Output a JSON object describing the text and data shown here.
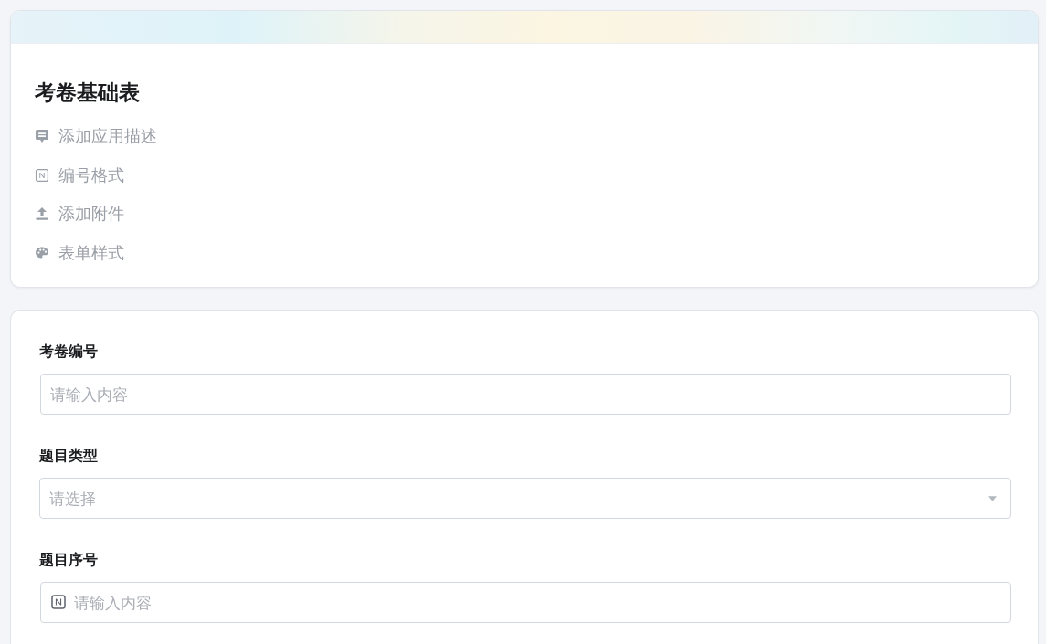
{
  "form_header": {
    "title": "考卷基础表",
    "actions": [
      {
        "kind": "description",
        "label": "添加应用描述"
      },
      {
        "kind": "numbering",
        "label": "编号格式"
      },
      {
        "kind": "attachment",
        "label": "添加附件"
      },
      {
        "kind": "style",
        "label": "表单样式"
      }
    ]
  },
  "fields": [
    {
      "kind": "text",
      "label": "考卷编号",
      "placeholder": "请输入内容"
    },
    {
      "kind": "select",
      "label": "题目类型",
      "placeholder": "请选择"
    },
    {
      "kind": "serial",
      "label": "题目序号",
      "placeholder": "请输入内容"
    }
  ]
}
